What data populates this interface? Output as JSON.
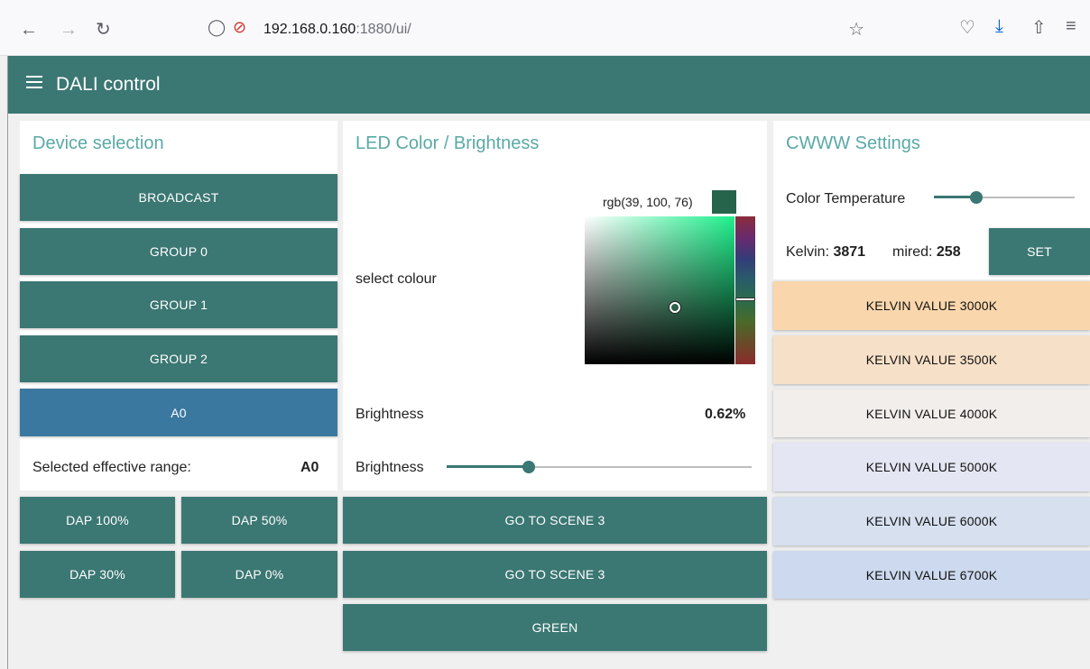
{
  "browser": {
    "url_host": "192.168.0.160",
    "url_path": ":1880/ui/"
  },
  "app": {
    "title": "DALI control"
  },
  "device_selection": {
    "title": "Device selection",
    "buttons": [
      "BROADCAST",
      "GROUP 0",
      "GROUP 1",
      "GROUP 2",
      "A0"
    ],
    "active_button": "A0",
    "effective_range_label": "Selected effective range:",
    "effective_range_value": "A0",
    "dap_buttons": [
      "DAP 100%",
      "DAP 50%",
      "DAP 30%",
      "DAP 0%"
    ]
  },
  "led": {
    "title": "LED Color / Brightness",
    "color_value": "rgb(39, 100, 76)",
    "color_hex": "#27644c",
    "select_colour_label": "select colour",
    "brightness_label": "Brightness",
    "brightness_value": "0.62%",
    "brightness_slider_label": "Brightness",
    "brightness_slider_fraction": 0.27,
    "buttons": [
      "GO TO SCENE 3",
      "GO TO SCENE 3",
      "GREEN"
    ]
  },
  "cwww": {
    "title": "CWWW Settings",
    "color_temp_label": "Color Temperature",
    "color_temp_slider_fraction": 0.3,
    "kelvin_label": "Kelvin:",
    "kelvin_value": "3871",
    "mired_label": "mired:",
    "mired_value": "258",
    "set_button": "SET",
    "kelvin_buttons": [
      {
        "label": "KELVIN VALUE 3000K",
        "color": "#f9d6ac"
      },
      {
        "label": "KELVIN VALUE 3500K",
        "color": "#f7e0c8"
      },
      {
        "label": "KELVIN VALUE 4000K",
        "color": "#f2eeec"
      },
      {
        "label": "KELVIN VALUE 5000K",
        "color": "#e4e6f3"
      },
      {
        "label": "KELVIN VALUE 6000K",
        "color": "#d6e0ef"
      },
      {
        "label": "KELVIN VALUE 6700K",
        "color": "#ccd9ee"
      }
    ]
  },
  "colors": {
    "primary": "#3b7773",
    "active": "#3a78a0",
    "title": "#5aa9a6"
  }
}
